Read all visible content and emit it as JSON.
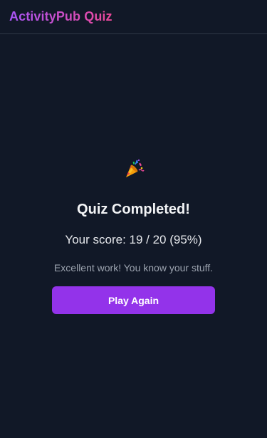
{
  "app": {
    "title": "ActivityPub Quiz"
  },
  "result": {
    "emoji_icon": "party-popper-icon",
    "heading": "Quiz Completed!",
    "score_prefix": "Your score: ",
    "score": "19 / 20 (95%)",
    "message": "Excellent work! You know your stuff.",
    "play_again_label": "Play Again"
  },
  "colors": {
    "background": "#111827",
    "brand_gradient_start": "#a855f7",
    "brand_gradient_end": "#ec4899",
    "button": "#9333ea"
  }
}
